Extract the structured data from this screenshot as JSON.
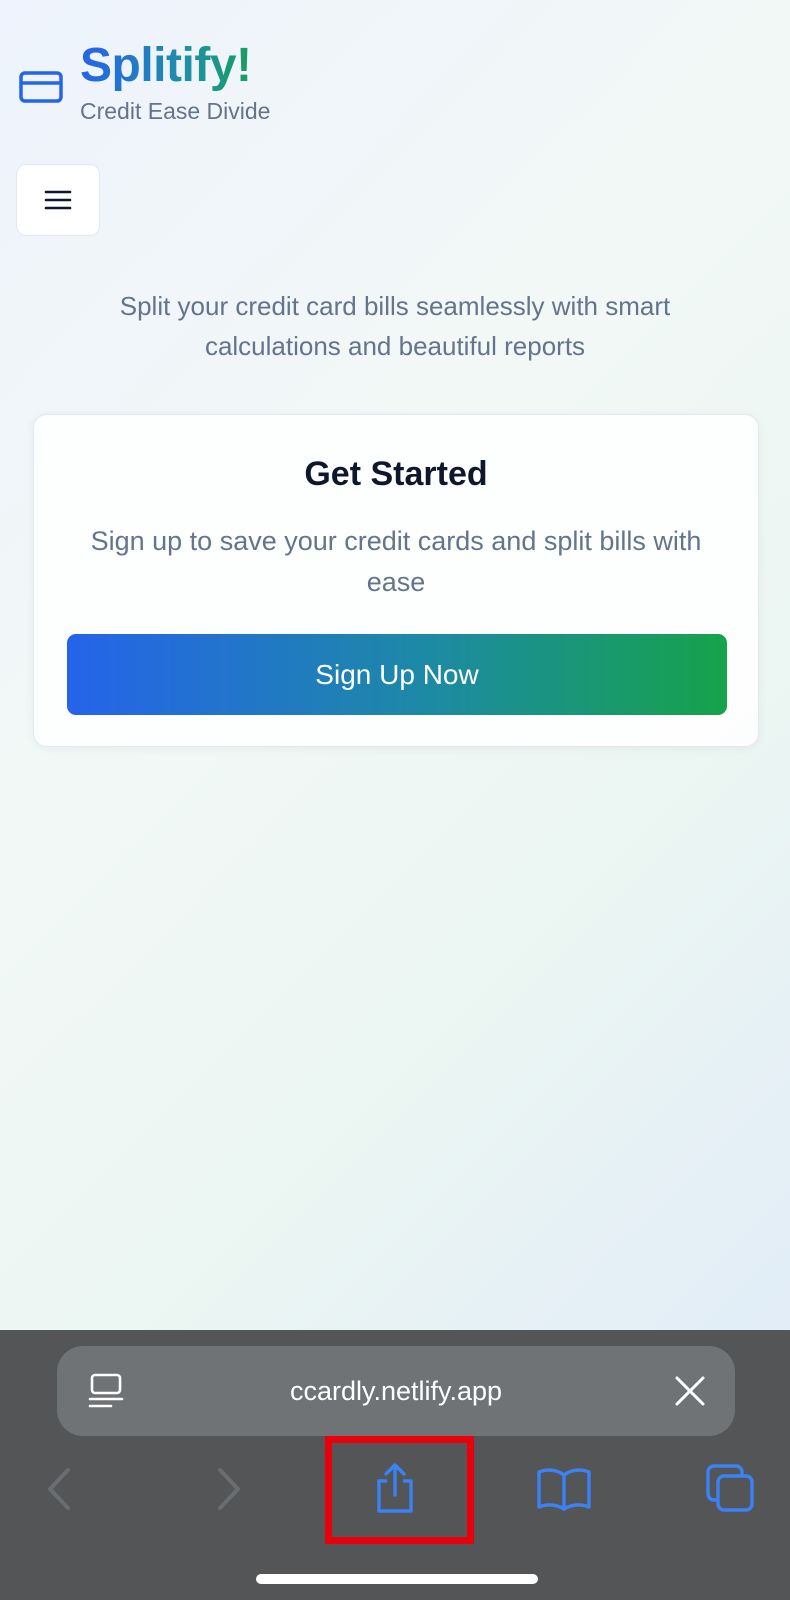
{
  "app": {
    "title": "Splitify!",
    "subtitle": "Credit Ease Divide",
    "brand_icon": "credit-card-icon",
    "menu_icon": "hamburger-menu-icon",
    "tagline": "Split your credit card bills seamlessly with smart calculations and beautiful reports"
  },
  "card": {
    "title": "Get Started",
    "description": "Sign up to save your credit cards and split bills with ease",
    "button_label": "Sign Up Now"
  },
  "browser": {
    "url": "ccardly.netlify.app",
    "reader_icon": "reader-mode-icon",
    "close_icon": "close-icon",
    "toolbar": [
      "back-icon",
      "forward-icon",
      "share-icon",
      "bookmarks-icon",
      "tabs-icon"
    ],
    "highlighted": "share-icon"
  },
  "colors": {
    "accent_blue": "#2563eb",
    "accent_green": "#16a34a",
    "muted_text": "#64748b",
    "browser_bar": "#545556",
    "highlight": "#e8000b"
  }
}
